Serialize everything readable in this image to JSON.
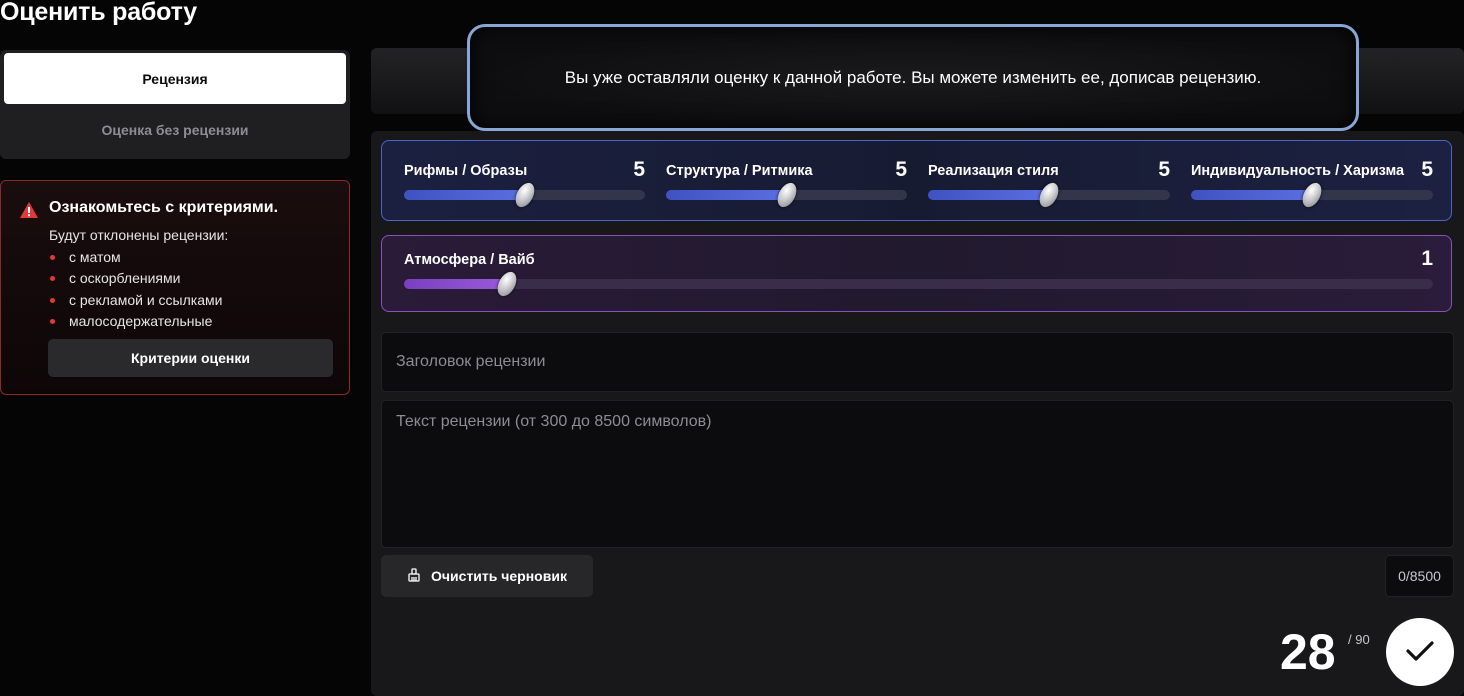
{
  "page": {
    "title": "Оценить работу"
  },
  "tabs": {
    "review": "Рецензия",
    "no_review": "Оценка без рецензии"
  },
  "criteria": {
    "title": "Ознакомьтесь с критериями.",
    "subtitle": "Будут отклонены рецензии:",
    "items": [
      "с матом",
      "с оскорблениями",
      "с рекламой и ссылками",
      "малосодержательные"
    ],
    "button": "Критерии оценки",
    "icon": "warning-triangle-icon",
    "accent_color": "#e03a3a"
  },
  "toast": {
    "message": "Вы уже оставляли оценку к данной работе. Вы можете изменить ее, дописав рецензию."
  },
  "ratings": {
    "min": 0,
    "max": 10,
    "items": [
      {
        "label": "Рифмы / Образы",
        "value": 5
      },
      {
        "label": "Структура / Ритмика",
        "value": 5
      },
      {
        "label": "Реализация стиля",
        "value": 5
      },
      {
        "label": "Индивидуальность / Харизма",
        "value": 5
      }
    ],
    "vibe": {
      "label": "Атмосфера / Вайб",
      "value": 1
    },
    "colors": {
      "main": "#4a64c8",
      "vibe": "#8a4fc0"
    }
  },
  "form": {
    "title_placeholder": "Заголовок рецензии",
    "title_value": "",
    "text_placeholder": "Текст рецензии (от 300 до 8500 символов)",
    "text_value": "",
    "clear_button": "Очистить черновик",
    "clear_icon": "broom-icon",
    "char_counter": "0/8500"
  },
  "score": {
    "total": "28",
    "max": "/ 90",
    "submit_icon": "checkmark-icon"
  }
}
